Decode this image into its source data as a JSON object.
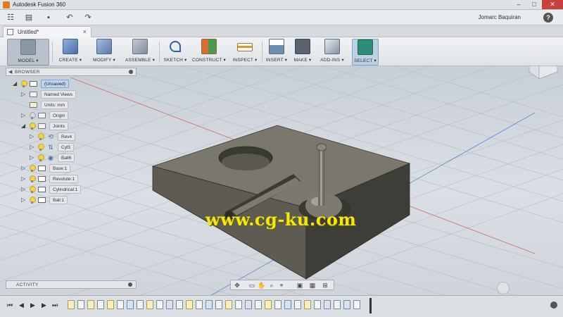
{
  "window": {
    "title": "Autodesk Fusion 360",
    "min": "–",
    "max": "□",
    "close": "✕"
  },
  "qab": {
    "grid": "☷",
    "file": "▤",
    "save": "▪",
    "undo": "↶",
    "redo": "↷",
    "user": "Jomarc Baquiran",
    "help": "?"
  },
  "doctab": {
    "title": "Untitled*",
    "close": "×"
  },
  "toolbar": {
    "items": [
      {
        "label": "MODEL ▾",
        "color": "#8c97a4"
      },
      {
        "label": "CREATE ▾",
        "color": "#5c7fb4"
      },
      {
        "label": "MODIFY ▾",
        "color": "#6b88b8"
      },
      {
        "label": "ASSEMBLE ▾",
        "color": "#8b93a8"
      },
      {
        "label": "SKETCH ▾",
        "color": "#2f63a6"
      },
      {
        "label": "CONSTRUCT ▾",
        "color": "#c6703a"
      },
      {
        "label": "INSPECT ▾",
        "color": "#cf9a32"
      },
      {
        "label": "INSERT ▾",
        "color": "#7e8d9a"
      },
      {
        "label": "MAKE ▾",
        "color": "#5a6470"
      },
      {
        "label": "ADD-INS ▾",
        "color": "#6d7f92"
      },
      {
        "label": "SELECT ▾",
        "color": "#2f8c7a"
      }
    ]
  },
  "browser": {
    "title": "BROWSER",
    "items": [
      {
        "label": "(Unsaved)"
      },
      {
        "label": "Named Views"
      },
      {
        "label": "Units: mm"
      },
      {
        "label": "Origin"
      },
      {
        "label": "Joints"
      },
      {
        "label": "Rev4"
      },
      {
        "label": "Cyl5"
      },
      {
        "label": "Ball6"
      },
      {
        "label": "Base:1"
      },
      {
        "label": "Revolute:1"
      },
      {
        "label": "Cylindrical:1"
      },
      {
        "label": "Ball:1"
      }
    ]
  },
  "activity": {
    "title": "ACTIVITY"
  },
  "navbar": {
    "orbit": "✥",
    "pan": "✋",
    "zoom": "⌕",
    "fit": "⌖",
    "display": "▣",
    "grid": "▦",
    "views": "⊞"
  },
  "timeline": {
    "first": "⏮",
    "prev": "◀",
    "play": "▶",
    "next": "▶",
    "last": "⏭"
  },
  "watermark": "www.cg-ku.com"
}
